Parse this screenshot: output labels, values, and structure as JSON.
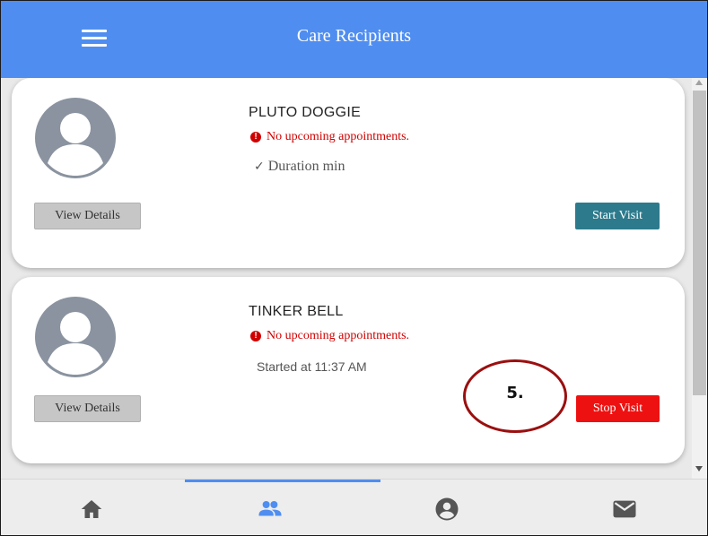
{
  "header": {
    "title": "Care Recipients",
    "menu_icon": "hamburger-menu-icon",
    "color": "#4f8ef0"
  },
  "recipients": [
    {
      "name": "PLUTO DOGGIE",
      "appointment_status": "No upcoming appointments.",
      "detail": "Duration min",
      "view_details_label": "View Details",
      "action_label": "Start Visit",
      "action_color": "#2c7a8c"
    },
    {
      "name": "TINKER BELL",
      "appointment_status": "No upcoming appointments.",
      "detail": "Started at 11:37 AM",
      "view_details_label": "View Details",
      "action_label": "Stop Visit",
      "action_color": "#ee1111"
    }
  ],
  "annotation": {
    "label": "5.",
    "color": "#9b0f0f"
  },
  "bottom_nav": {
    "items": [
      {
        "icon": "home-icon"
      },
      {
        "icon": "people-icon",
        "active": true
      },
      {
        "icon": "account-circle-icon"
      },
      {
        "icon": "mail-icon"
      }
    ]
  }
}
